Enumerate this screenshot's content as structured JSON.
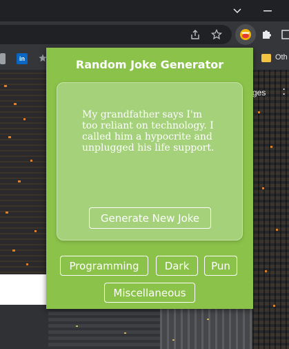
{
  "popup": {
    "title": "Random Joke Generator",
    "joke": "My grandfather says I'm too reliant on technology. I called him a hypocrite and unplugged his life support.",
    "generate_label": "Generate New Joke",
    "categories": [
      {
        "label": "Programming"
      },
      {
        "label": "Dark"
      },
      {
        "label": "Pun"
      },
      {
        "label": "Miscellaneous"
      }
    ]
  },
  "bookmarks": {
    "linkedin_glyph": "in",
    "other_label": "Oth"
  },
  "page": {
    "snippet": "ges"
  },
  "colors": {
    "popup_bg": "#8bc34a",
    "card_bg": "#a4d17a",
    "text": "#ffffff",
    "chrome_dark": "#202124",
    "chrome_toolbar": "#35363a"
  },
  "icons": [
    "chevron-down-icon",
    "minimize-icon",
    "share-icon",
    "star-icon",
    "emoji-extension-icon",
    "puzzle-extensions-icon",
    "linkedin-icon",
    "bookmark-star-icon",
    "folder-icon",
    "more-dots-icon"
  ]
}
